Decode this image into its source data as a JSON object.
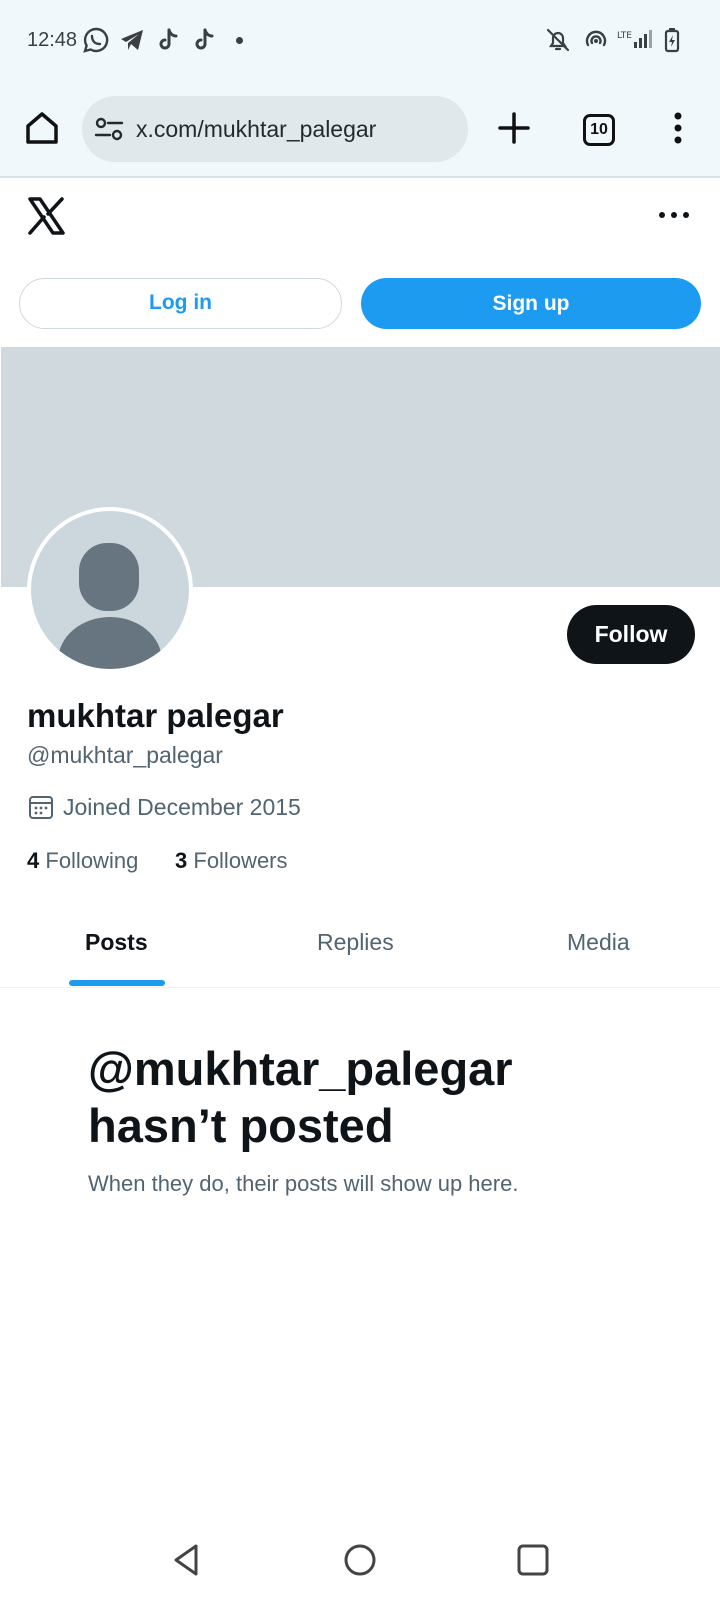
{
  "status_bar": {
    "time": "12:48",
    "icons": [
      "whatsapp-icon",
      "telegram-icon",
      "tiktok-icon",
      "tiktok-icon",
      "dot-icon",
      "bell-off-icon",
      "hotspot-icon",
      "lte-signal-icon",
      "battery-charging-icon"
    ]
  },
  "browser": {
    "url": "x.com/mukhtar_palegar",
    "tab_count": "10"
  },
  "header": {
    "login_label": "Log in",
    "signup_label": "Sign up"
  },
  "profile": {
    "display_name": "mukhtar palegar",
    "handle": "@mukhtar_palegar",
    "joined": "Joined December 2015",
    "following_count": "4",
    "following_label": "Following",
    "followers_count": "3",
    "followers_label": "Followers",
    "follow_label": "Follow"
  },
  "tabs": [
    {
      "label": "Posts",
      "active": true
    },
    {
      "label": "Replies",
      "active": false
    },
    {
      "label": "Media",
      "active": false
    }
  ],
  "empty_state": {
    "title": "@mukhtar_palegar hasn’t posted",
    "subtitle": "When they do, their posts will show up here."
  },
  "colors": {
    "accent": "#1d9bf0",
    "text_primary": "#0f1419",
    "text_secondary": "#536471",
    "banner": "#cfd9de"
  }
}
